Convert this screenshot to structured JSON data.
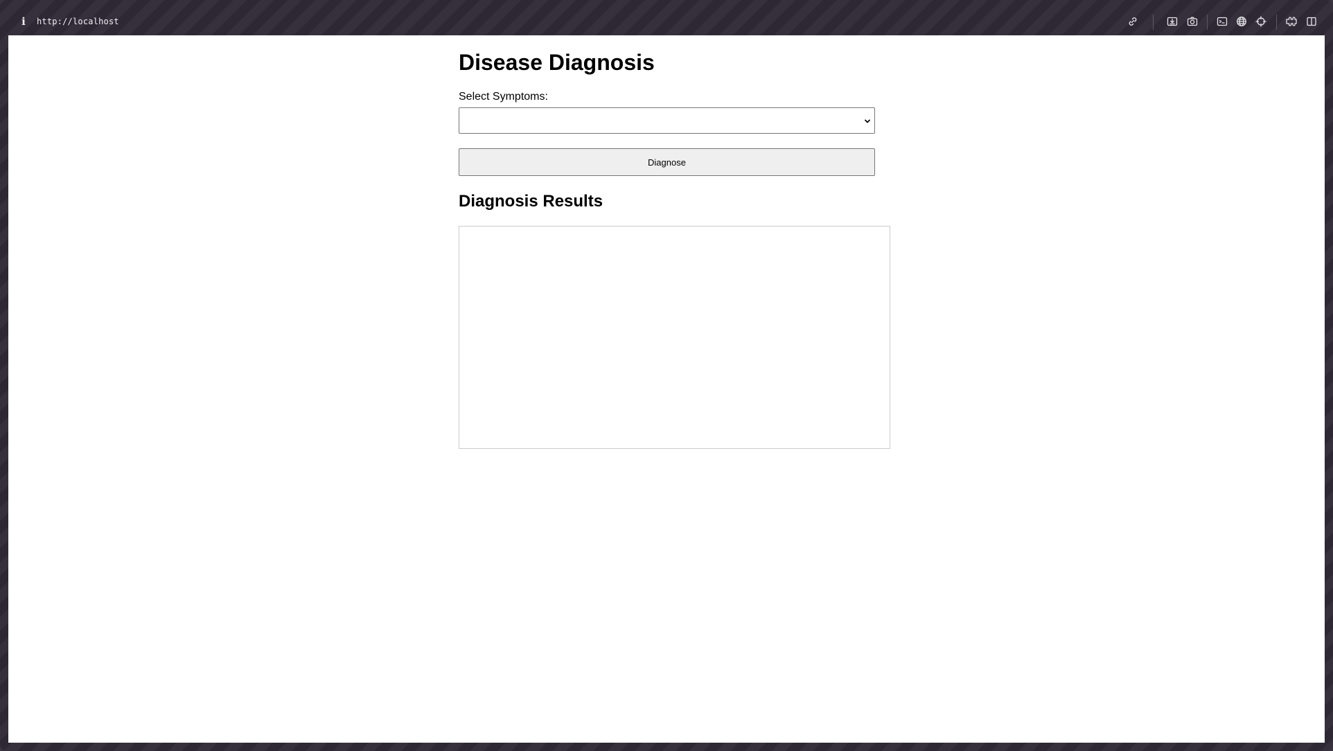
{
  "browser": {
    "url": "http://localhost",
    "info_glyph": "i",
    "toolbar_icons": [
      "link-icon",
      "download-icon",
      "camera-icon",
      "terminal-icon",
      "globe-icon",
      "crosshair-icon",
      "extension-icon",
      "sidebar-icon"
    ]
  },
  "page": {
    "title": "Disease Diagnosis",
    "symptoms": {
      "label": "Select Symptoms:",
      "selected_value": ""
    },
    "diagnose_button": "Diagnose",
    "results": {
      "heading": "Diagnosis Results",
      "content": ""
    }
  },
  "colors": {
    "frame": "#2d2833",
    "page_background": "#ffffff",
    "button_background": "#efefef",
    "control_border": "#767676",
    "results_border": "#cccccc"
  }
}
